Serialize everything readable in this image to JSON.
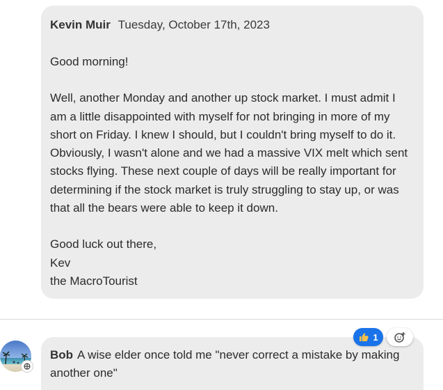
{
  "message": {
    "author": "Kevin Muir",
    "date": "Tuesday, October 17th, 2023",
    "greeting": "Good morning!",
    "body_lines": [
      "Well, another Monday and another up stock market. I must admit I",
      "am a little disappointed with myself for not bringing in more of my",
      "short on Friday. I knew I should, but I couldn't bring myself to do it.",
      "Obviously, I wasn't alone and we had a massive VIX melt which sent",
      "stocks flying. These next couple of days will be really important for",
      "determining if the stock market is truly struggling to stay up, or was",
      "that all the bears were able to keep it down."
    ],
    "signoff": "Good luck out there,",
    "signature_name": "Kev",
    "signature_org": "the MacroTourist"
  },
  "reactions": {
    "thumbs_up_count": "1",
    "thumbs_up_icon": "thumbs-up-icon",
    "add_reaction_icon": "add-emoji-icon",
    "pill_color": "#1a73e8"
  },
  "reply": {
    "author": "Bob",
    "text_line1": "A wise elder once told me \"never correct a mistake by making",
    "text_line2": "another one\""
  }
}
